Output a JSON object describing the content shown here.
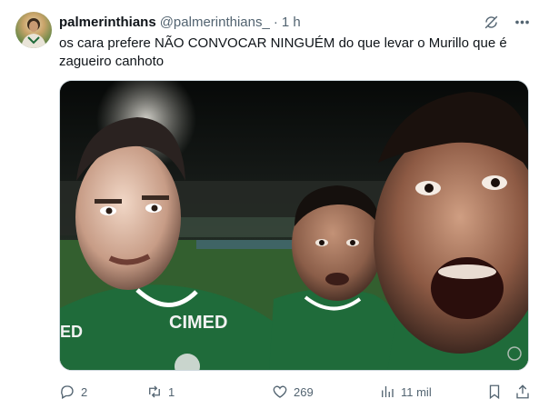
{
  "tweet": {
    "display_name": "palmerinthians",
    "handle": "@palmerinthians_",
    "separator": "·",
    "time": "1 h",
    "text": "os cara prefere NÃO CONVOCAR NINGUÉM do que levar o Murillo que é zagueiro canhoto",
    "media": {
      "jersey_sponsor": "CIMED",
      "jersey_sponsor_partial": "ED"
    },
    "metrics": {
      "replies": "2",
      "retweets": "1",
      "likes": "269",
      "views": "11 mil"
    }
  },
  "icons": {
    "grok": "grok-icon",
    "more": "more-icon",
    "reply": "reply-icon",
    "retweet": "retweet-icon",
    "like": "like-icon",
    "views": "views-icon",
    "bookmark": "bookmark-icon",
    "share": "share-icon"
  },
  "colors": {
    "text": "#0f1419",
    "secondary": "#536471",
    "border": "#cfd9de",
    "jersey_green": "#1f6b3a"
  }
}
